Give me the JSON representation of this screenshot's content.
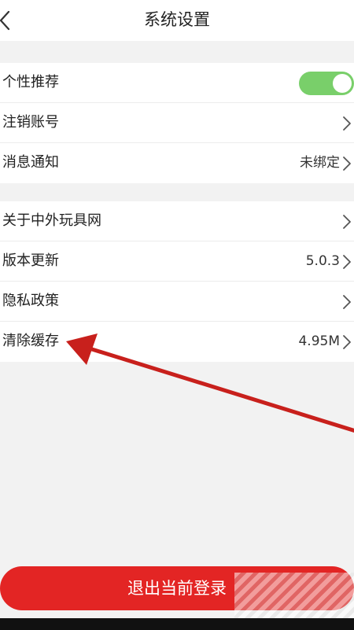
{
  "header": {
    "title": "系统设置",
    "back_icon": "chevron-left-icon"
  },
  "groups": [
    {
      "items": [
        {
          "label": "个性推荐",
          "control": "toggle",
          "toggle_on": true
        },
        {
          "label": "注销账号",
          "value": ""
        },
        {
          "label": "消息通知",
          "value": "未绑定"
        }
      ]
    },
    {
      "items": [
        {
          "label": "关于中外玩具网",
          "value": ""
        },
        {
          "label": "版本更新",
          "value": "5.0.3"
        },
        {
          "label": "隐私政策",
          "value": ""
        },
        {
          "label": "清除缓存",
          "value": "4.95M"
        }
      ]
    }
  ],
  "logout_button": {
    "label": "退出当前登录"
  },
  "colors": {
    "accent_red": "#e32524",
    "toggle_green": "#79cf6a",
    "background": "#f2f2f2"
  }
}
